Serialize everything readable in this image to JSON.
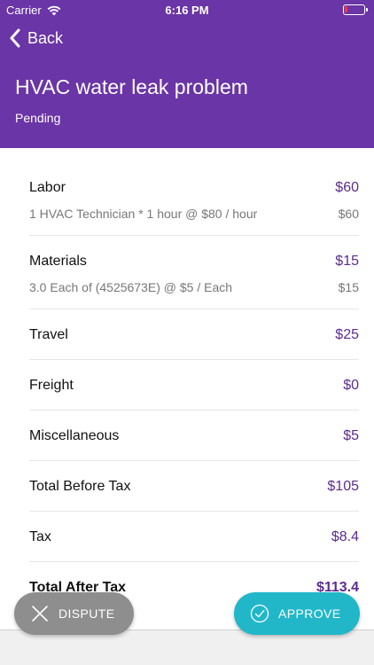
{
  "status_bar": {
    "carrier": "Carrier",
    "time": "6:16 PM"
  },
  "header": {
    "back_label": "Back",
    "title": "HVAC water leak problem",
    "status": "Pending"
  },
  "rows": [
    {
      "label": "Labor",
      "value": "$60",
      "detail": "1 HVAC Technician * 1 hour @ $80 / hour",
      "detail_value": "$60"
    },
    {
      "label": "Materials",
      "value": "$15",
      "detail": "3.0 Each of  (4525673E) @ $5 / Each",
      "detail_value": "$15"
    },
    {
      "label": "Travel",
      "value": "$25"
    },
    {
      "label": "Freight",
      "value": "$0"
    },
    {
      "label": "Miscellaneous",
      "value": "$5"
    },
    {
      "label": "Total Before Tax",
      "value": "$105"
    },
    {
      "label": "Tax",
      "value": "$8.4"
    },
    {
      "label": "Total After Tax",
      "value": "$113.4"
    }
  ],
  "actions": {
    "dispute_label": "DISPUTE",
    "approve_label": "APPROVE"
  },
  "colors": {
    "header_bg": "#6a35a6",
    "value_text": "#5b2c91",
    "dispute_bg": "#8e8e8e",
    "approve_bg": "#21b7c9"
  },
  "icons": {
    "back": "chevron-left-icon",
    "wifi": "wifi-icon",
    "battery": "battery-icon",
    "dispute": "close-icon",
    "approve": "check-circle-icon"
  }
}
